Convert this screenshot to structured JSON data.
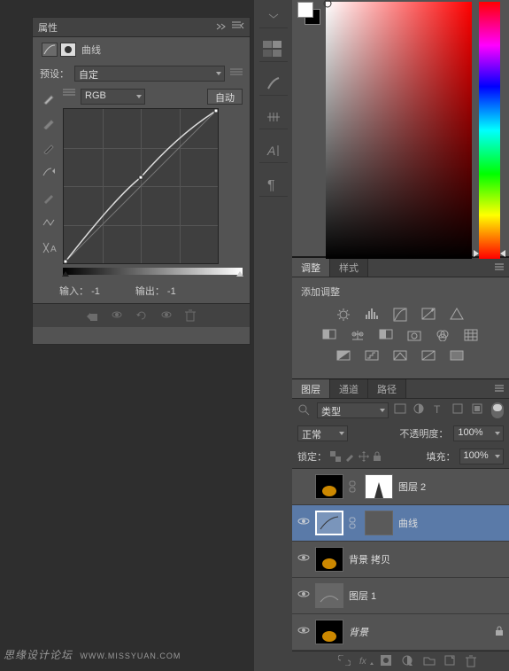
{
  "properties": {
    "title": "属性",
    "adjustment_name": "曲线",
    "preset_label": "预设：",
    "preset_value": "自定",
    "channel_value": "RGB",
    "auto_label": "自动",
    "input_label": "输入：",
    "input_value": "-1",
    "output_label": "输出：",
    "output_value": "-1"
  },
  "adjustments": {
    "tab1": "调整",
    "tab2": "样式",
    "title": "添加调整"
  },
  "layers": {
    "tabs": {
      "layers": "图层",
      "channels": "通道",
      "paths": "路径"
    },
    "filter_label": "类型",
    "blend_mode": "正常",
    "opacity_label": "不透明度：",
    "opacity_value": "100%",
    "lock_label": "锁定：",
    "fill_label": "填充：",
    "fill_value": "100%",
    "items": [
      {
        "name": "图层 2",
        "visible": false
      },
      {
        "name": "曲线",
        "visible": true,
        "selected": true
      },
      {
        "name": "背景 拷贝",
        "visible": true
      },
      {
        "name": "图层 1",
        "visible": true
      },
      {
        "name": "背景",
        "visible": true,
        "locked": true
      }
    ]
  },
  "watermark": {
    "text": "思缘设计论坛",
    "url": "WWW.MISSYUAN.COM"
  }
}
